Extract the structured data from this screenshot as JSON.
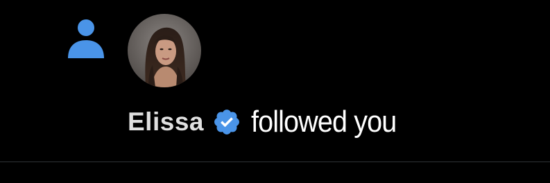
{
  "notification": {
    "icon": "person-icon",
    "user_name": "Elissa",
    "verified_icon": "verified-badge-icon",
    "action_text": "followed you"
  },
  "colors": {
    "background": "#000000",
    "accent": "#4a94e8",
    "name_text": "#e0e0e0",
    "action_text": "#ffffff",
    "divider": "#2f3336"
  }
}
